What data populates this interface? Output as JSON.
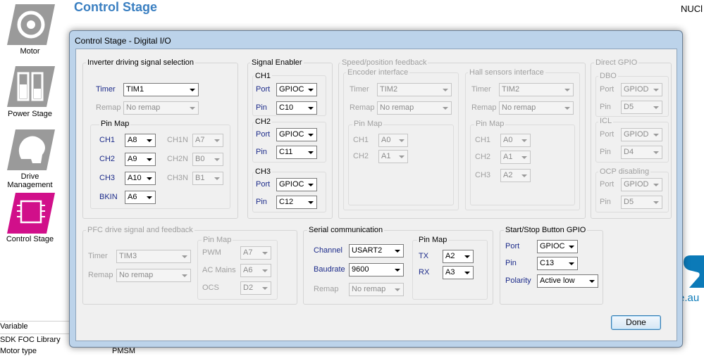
{
  "app": {
    "title": "Control Stage",
    "corner_text": "NUCl",
    "logo_text": "e.au",
    "sidebar": [
      {
        "label": "Motor"
      },
      {
        "label": "Power Stage"
      },
      {
        "label": "Drive Management"
      },
      {
        "label": "Control Stage"
      }
    ],
    "bottom_rows": [
      "Variable",
      "SDK FOC Library",
      "Motor type",
      "PMSM"
    ]
  },
  "dialog": {
    "title": "Control Stage - Digital I/O",
    "done_label": "Done",
    "inverter": {
      "title": "Inverter driving signal selection",
      "timer_label": "Timer",
      "timer_value": "TIM1",
      "remap_label": "Remap",
      "remap_value": "No remap",
      "pinmap_title": "Pin Map",
      "ch1_label": "CH1",
      "ch1_value": "A8",
      "ch2_label": "CH2",
      "ch2_value": "A9",
      "ch3_label": "CH3",
      "ch3_value": "A10",
      "bkin_label": "BKIN",
      "bkin_value": "A6",
      "ch1n_label": "CH1N",
      "ch1n_value": "A7",
      "ch2n_label": "CH2N",
      "ch2n_value": "B0",
      "ch3n_label": "CH3N",
      "ch3n_value": "B1"
    },
    "signal_enabler": {
      "title": "Signal Enabler",
      "ch1": {
        "title": "CH1",
        "port_label": "Port",
        "port_value": "GPIOC",
        "pin_label": "Pin",
        "pin_value": "C10"
      },
      "ch2": {
        "title": "CH2",
        "port_label": "Port",
        "port_value": "GPIOC",
        "pin_label": "Pin",
        "pin_value": "C11"
      },
      "ch3": {
        "title": "CH3",
        "port_label": "Port",
        "port_value": "GPIOC",
        "pin_label": "Pin",
        "pin_value": "C12"
      }
    },
    "speed_feedback": {
      "title": "Speed/position feedback",
      "encoder": {
        "title": "Encoder interface",
        "timer_label": "Timer",
        "timer_value": "TIM2",
        "remap_label": "Remap",
        "remap_value": "No remap",
        "pinmap_title": "Pin Map",
        "ch1_label": "CH1",
        "ch1_value": "A0",
        "ch2_label": "CH2",
        "ch2_value": "A1"
      },
      "hall": {
        "title": "Hall sensors interface",
        "timer_label": "Timer",
        "timer_value": "TIM2",
        "remap_label": "Remap",
        "remap_value": "No remap",
        "pinmap_title": "Pin Map",
        "ch1_label": "CH1",
        "ch1_value": "A0",
        "ch2_label": "CH2",
        "ch2_value": "A1",
        "ch3_label": "CH3",
        "ch3_value": "A2"
      }
    },
    "direct_gpio": {
      "title": "Direct GPIO",
      "dbo": {
        "title": "DBO",
        "port_label": "Port",
        "port_value": "GPIOD",
        "pin_label": "Pin",
        "pin_value": "D5"
      },
      "icl": {
        "title": "ICL",
        "port_label": "Port",
        "port_value": "GPIOD",
        "pin_label": "Pin",
        "pin_value": "D4"
      },
      "ocp": {
        "title": "OCP disabling",
        "port_label": "Port",
        "port_value": "GPIOD",
        "pin_label": "Pin",
        "pin_value": "D5"
      }
    },
    "pfc": {
      "title": "PFC drive signal and feedback",
      "timer_label": "Timer",
      "timer_value": "TIM3",
      "remap_label": "Remap",
      "remap_value": "No remap",
      "pinmap_title": "Pin Map",
      "pwm_label": "PWM",
      "pwm_value": "A7",
      "acmains_label": "AC Mains",
      "acmains_value": "A6",
      "ocs_label": "OCS",
      "ocs_value": "D2"
    },
    "serial": {
      "title": "Serial communication",
      "channel_label": "Channel",
      "channel_value": "USART2",
      "baudrate_label": "Baudrate",
      "baudrate_value": "9600",
      "remap_label": "Remap",
      "remap_value": "No remap",
      "pinmap_title": "Pin Map",
      "tx_label": "TX",
      "tx_value": "A2",
      "rx_label": "RX",
      "rx_value": "A3"
    },
    "startstop": {
      "title": "Start/Stop Button GPIO",
      "port_label": "Port",
      "port_value": "GPIOC",
      "pin_label": "Pin",
      "pin_value": "C13",
      "polarity_label": "Polarity",
      "polarity_value": "Active low"
    }
  },
  "colors": {
    "accent_blue": "#3a7fc1",
    "label_blue": "#1c2b8a",
    "control_stage_magenta": "#d10f8a",
    "dialog_frame": "#bcd3ea"
  }
}
